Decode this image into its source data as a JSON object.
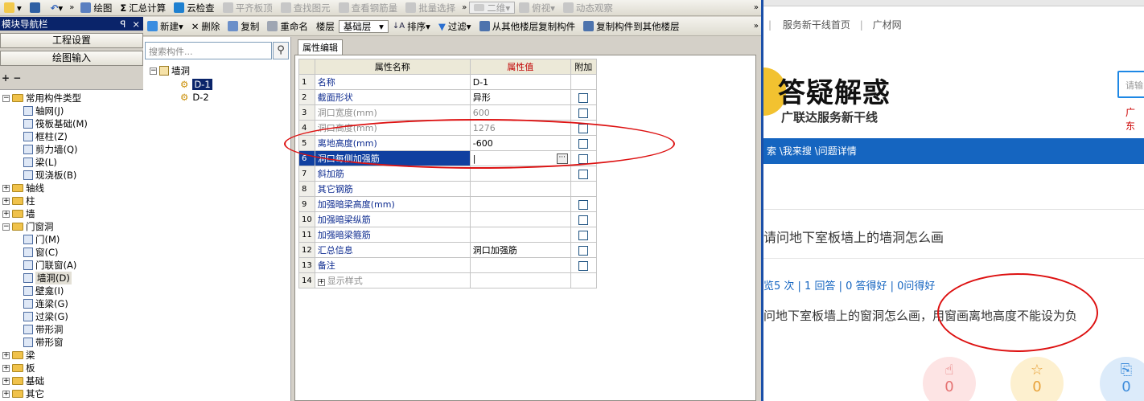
{
  "toolbar1": {
    "items": [
      {
        "label": "绘图"
      },
      {
        "label": "汇总计算"
      },
      {
        "label": "云检查"
      },
      {
        "label": "平齐板顶"
      },
      {
        "label": "查找图元"
      },
      {
        "label": "查看钢筋量"
      },
      {
        "label": "批量选择"
      },
      {
        "label": "二维"
      },
      {
        "label": "俯视"
      },
      {
        "label": "动态观察"
      }
    ],
    "more": "»",
    "sigma": "Σ"
  },
  "toolbar2": {
    "new": "新建",
    "delete": "删除",
    "copy": "复制",
    "rename": "重命名",
    "floor_label": "楼层",
    "floor_value": "基础层",
    "sort": "排序",
    "filter": "过滤",
    "copy_from": "从其他楼层复制构件",
    "copy_to": "复制构件到其他楼层",
    "more": "»"
  },
  "nav": {
    "title": "模块导航栏",
    "pin": "ꟼ",
    "close": "×",
    "btn_settings": "工程设置",
    "btn_drawing": "绘图输入",
    "plus_minus": "+  −"
  },
  "tree": [
    {
      "label": "常用构件类型",
      "level": 0,
      "pm": "−",
      "type": "folder"
    },
    {
      "label": "轴网(J)",
      "level": 2,
      "type": "item"
    },
    {
      "label": "筏板基础(M)",
      "level": 2,
      "type": "item"
    },
    {
      "label": "框柱(Z)",
      "level": 2,
      "type": "item"
    },
    {
      "label": "剪力墙(Q)",
      "level": 2,
      "type": "item"
    },
    {
      "label": "梁(L)",
      "level": 2,
      "type": "item"
    },
    {
      "label": "现浇板(B)",
      "level": 2,
      "type": "item"
    },
    {
      "label": "轴线",
      "level": 0,
      "pm": "+",
      "type": "folder"
    },
    {
      "label": "柱",
      "level": 0,
      "pm": "+",
      "type": "folder"
    },
    {
      "label": "墙",
      "level": 0,
      "pm": "+",
      "type": "folder"
    },
    {
      "label": "门窗洞",
      "level": 0,
      "pm": "−",
      "type": "folder"
    },
    {
      "label": "门(M)",
      "level": 2,
      "type": "item"
    },
    {
      "label": "窗(C)",
      "level": 2,
      "type": "item"
    },
    {
      "label": "门联窗(A)",
      "level": 2,
      "type": "item"
    },
    {
      "label": "墙洞(D)",
      "level": 2,
      "type": "item",
      "selected": true
    },
    {
      "label": "壁龛(I)",
      "level": 2,
      "type": "item"
    },
    {
      "label": "连梁(G)",
      "level": 2,
      "type": "item"
    },
    {
      "label": "过梁(G)",
      "level": 2,
      "type": "item"
    },
    {
      "label": "带形洞",
      "level": 2,
      "type": "item"
    },
    {
      "label": "带形窗",
      "level": 2,
      "type": "item"
    },
    {
      "label": "梁",
      "level": 0,
      "pm": "+",
      "type": "folder"
    },
    {
      "label": "板",
      "level": 0,
      "pm": "+",
      "type": "folder"
    },
    {
      "label": "基础",
      "level": 0,
      "pm": "+",
      "type": "folder"
    },
    {
      "label": "其它",
      "level": 0,
      "pm": "+",
      "type": "folder"
    }
  ],
  "search": {
    "placeholder": "搜索构件...",
    "icon": "search-icon"
  },
  "comptree": {
    "root": "墙洞",
    "items": [
      "D-1",
      "D-2"
    ]
  },
  "props": {
    "tab": "属性编辑",
    "headers": [
      "属性名称",
      "属性值",
      "附加"
    ],
    "rows": [
      {
        "n": "1",
        "name": "名称",
        "val": "D-1",
        "gray": false,
        "cb": false
      },
      {
        "n": "2",
        "name": "截面形状",
        "val": "异形",
        "gray": false,
        "cb": true
      },
      {
        "n": "3",
        "name": "洞口宽度(mm)",
        "val": "600",
        "gray": true,
        "cb": true
      },
      {
        "n": "4",
        "name": "洞口高度(mm)",
        "val": "1276",
        "gray": true,
        "cb": true
      },
      {
        "n": "5",
        "name": "离地高度(mm)",
        "val": "-600",
        "gray": false,
        "cb": true
      },
      {
        "n": "6",
        "name": "洞口每侧加强筋",
        "val": "",
        "gray": false,
        "cb": true,
        "sel": true
      },
      {
        "n": "7",
        "name": "斜加筋",
        "val": "",
        "gray": false,
        "cb": true
      },
      {
        "n": "8",
        "name": "其它钢筋",
        "val": "",
        "gray": false,
        "cb": false
      },
      {
        "n": "9",
        "name": "加强暗梁高度(mm)",
        "val": "",
        "gray": false,
        "cb": true
      },
      {
        "n": "10",
        "name": "加强暗梁纵筋",
        "val": "",
        "gray": false,
        "cb": true
      },
      {
        "n": "11",
        "name": "加强暗梁箍筋",
        "val": "",
        "gray": false,
        "cb": true
      },
      {
        "n": "12",
        "name": "汇总信息",
        "val": "洞口加强筋",
        "gray": false,
        "cb": true
      },
      {
        "n": "13",
        "name": "备注",
        "val": "",
        "gray": false,
        "cb": true
      },
      {
        "n": "14",
        "name": "显示样式",
        "val": "",
        "gray": true,
        "cb": false,
        "expand": "+"
      }
    ]
  },
  "browser": {
    "nav": [
      "服务新干线首页",
      "广材网"
    ],
    "sep": "|",
    "logo_text": "答疑解惑",
    "logo_sub": "广联达服务新干线",
    "search_hint": "请输",
    "side_text": "广东",
    "breadcrumb": "\\我来搜 \\问题详情",
    "breadcrumb_prefix": "索",
    "question_title": "请问地下室板墙上的墙洞怎么画",
    "stats": "览5 次 | 1 回答 | 0 答得好 | 0问得好",
    "body": "问地下室板墙上的窗洞怎么画，用窗画离地高度不能设为负",
    "counts": [
      "0",
      "0",
      "0"
    ]
  },
  "colors": {
    "accent": "#1565c0",
    "annotation": "#dd1111"
  }
}
